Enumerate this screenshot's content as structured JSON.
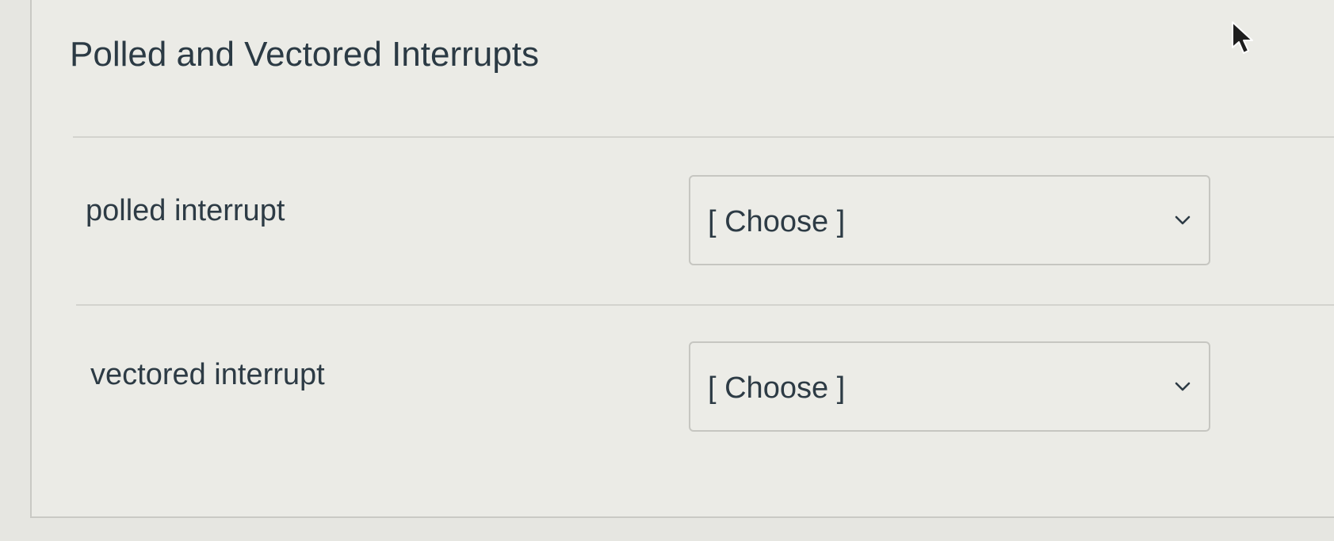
{
  "question": {
    "title": "Polled and Vectored Interrupts"
  },
  "matches": [
    {
      "label": "polled interrupt",
      "selected": "[ Choose ]"
    },
    {
      "label": "vectored interrupt",
      "selected": "[ Choose ]"
    }
  ],
  "icons": {
    "dropdown": "chevron-down-icon",
    "pointer": "mouse-cursor-icon"
  },
  "colors": {
    "background": "#e6e6e1",
    "text": "#2d3b45",
    "border": "#c6c6c1"
  }
}
